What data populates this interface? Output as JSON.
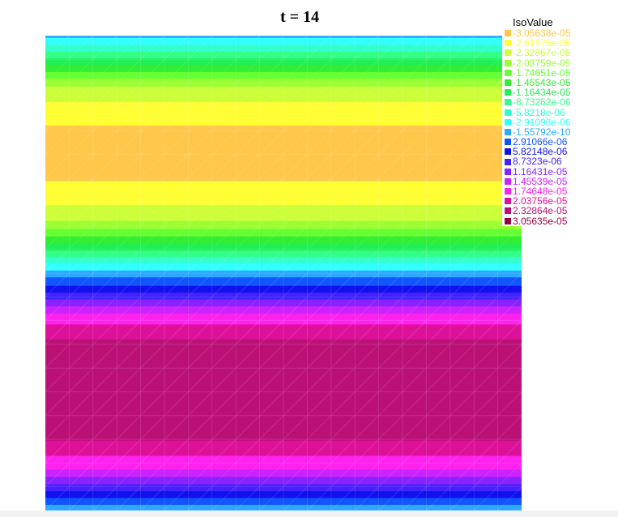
{
  "chart_data": {
    "type": "heatmap",
    "title": "t = 14",
    "legend": {
      "title": "IsoValue",
      "placement": "top-right",
      "entries": [
        {
          "label": "-3.05638e-05",
          "color": "#ffc84a"
        },
        {
          "label": "-2.61975e-05",
          "color": "#ffff33"
        },
        {
          "label": "-2.32867e-05",
          "color": "#ccff3a"
        },
        {
          "label": "-2.03759e-05",
          "color": "#99ff33"
        },
        {
          "label": "-1.74651e-05",
          "color": "#66ff33"
        },
        {
          "label": "-1.45543e-05",
          "color": "#33ee33"
        },
        {
          "label": "-1.16434e-05",
          "color": "#22ee55"
        },
        {
          "label": "-8.73262e-06",
          "color": "#33ff88"
        },
        {
          "label": "-5.8218e-06",
          "color": "#33ffcc"
        },
        {
          "label": "-2.91098e-06",
          "color": "#33ffff"
        },
        {
          "label": "-1.55792e-10",
          "color": "#2ea8ff"
        },
        {
          "label": "2.91066e-06",
          "color": "#1155ff"
        },
        {
          "label": "5.82148e-06",
          "color": "#1111ee"
        },
        {
          "label": "8.7323e-06",
          "color": "#4422ff"
        },
        {
          "label": "1.16431e-05",
          "color": "#8822ff"
        },
        {
          "label": "1.45539e-05",
          "color": "#cc22ff"
        },
        {
          "label": "1.74648e-05",
          "color": "#ff22ee"
        },
        {
          "label": "2.03756e-05",
          "color": "#dd1199"
        },
        {
          "label": "2.32864e-05",
          "color": "#bb1177"
        },
        {
          "label": "3.05635e-05",
          "color": "#990044"
        }
      ]
    },
    "bands_top_to_bottom": [
      {
        "level": 10,
        "extent": 0.004
      },
      {
        "level": 9,
        "extent": 0.012
      },
      {
        "level": 8,
        "extent": 0.012
      },
      {
        "level": 7,
        "extent": 0.012
      },
      {
        "level": 6,
        "extent": 0.012
      },
      {
        "level": 5,
        "extent": 0.012
      },
      {
        "level": 4,
        "extent": 0.012
      },
      {
        "level": 3,
        "extent": 0.014
      },
      {
        "level": 2,
        "extent": 0.027
      },
      {
        "level": 1,
        "extent": 0.041
      },
      {
        "level": 0,
        "extent": 0.098
      },
      {
        "level": 1,
        "extent": 0.042
      },
      {
        "level": 2,
        "extent": 0.028
      },
      {
        "level": 3,
        "extent": 0.014
      },
      {
        "level": 4,
        "extent": 0.013
      },
      {
        "level": 5,
        "extent": 0.013
      },
      {
        "level": 6,
        "extent": 0.012
      },
      {
        "level": 7,
        "extent": 0.011
      },
      {
        "level": 8,
        "extent": 0.011
      },
      {
        "level": 9,
        "extent": 0.013
      },
      {
        "level": 10,
        "extent": 0.012
      },
      {
        "level": 11,
        "extent": 0.015
      },
      {
        "level": 12,
        "extent": 0.012
      },
      {
        "level": 13,
        "extent": 0.012
      },
      {
        "level": 14,
        "extent": 0.012
      },
      {
        "level": 15,
        "extent": 0.013
      },
      {
        "level": 16,
        "extent": 0.019
      },
      {
        "level": 17,
        "extent": 0.026
      },
      {
        "level": 18,
        "extent": 0.178
      },
      {
        "level": 17,
        "extent": 0.027
      },
      {
        "level": 16,
        "extent": 0.024
      },
      {
        "level": 15,
        "extent": 0.013
      },
      {
        "level": 14,
        "extent": 0.013
      },
      {
        "level": 13,
        "extent": 0.012
      },
      {
        "level": 12,
        "extent": 0.012
      },
      {
        "level": 11,
        "extent": 0.012
      },
      {
        "level": 10,
        "extent": 0.01
      }
    ],
    "grid": true
  }
}
